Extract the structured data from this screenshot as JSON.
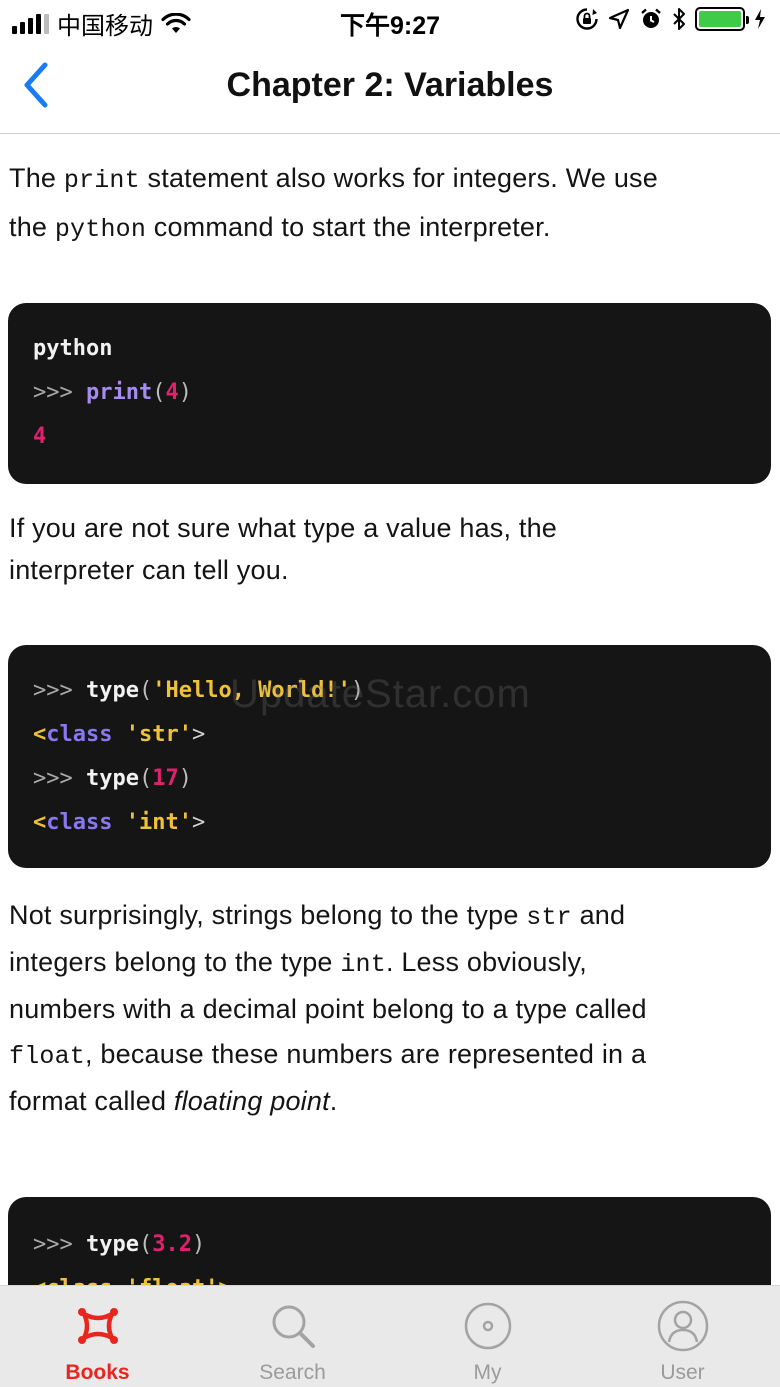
{
  "status_bar": {
    "carrier": "中国移动",
    "time": "下午9:27"
  },
  "nav": {
    "title": "Chapter 2: Variables"
  },
  "content": {
    "p1": {
      "t1": "The ",
      "c1": "print",
      "t2": " statement also works for integers. We use",
      "t3": "the ",
      "c2": "python",
      "t4": " command to start the interpreter."
    },
    "code1": {
      "line1": "python",
      "prompt": ">>> ",
      "func": "print",
      "paren_open": "(",
      "arg": "4",
      "paren_close": ")",
      "output": "4"
    },
    "p2": {
      "line1": "If you are not sure what type a value has, the",
      "line2": "interpreter can tell you."
    },
    "code2": {
      "prompt": ">>> ",
      "func": "type",
      "paren_open": "(",
      "paren_close": ")",
      "str_arg": "'Hello, World!'",
      "class_lt": "<",
      "class_kw": "class",
      "class_gt": ">",
      "str_type": "'str'",
      "int_arg": "17",
      "int_type": "'int'"
    },
    "p3": {
      "t1": "Not surprisingly, strings belong to the type ",
      "c1": "str",
      "t2": " and",
      "t3": "integers belong to the type ",
      "c2": "int",
      "t4": ". Less obviously,",
      "t5": "numbers with a decimal point belong to a type called",
      "c3": "float",
      "t6": ", because these numbers are represented in a",
      "t7": "format called ",
      "em1": "floating point",
      "t8": "."
    },
    "code3": {
      "prompt": ">>> ",
      "func": "type",
      "paren_open": "(",
      "arg": "3.2",
      "paren_close": ")",
      "partial": "<class 'float'>"
    },
    "watermark": "UpdateStar.com"
  },
  "tabs": [
    {
      "label": "Books",
      "icon": "books-icon",
      "active": true
    },
    {
      "label": "Search",
      "icon": "search-icon",
      "active": false
    },
    {
      "label": "My",
      "icon": "disc-icon",
      "active": false
    },
    {
      "label": "User",
      "icon": "user-icon",
      "active": false
    }
  ],
  "colors": {
    "accent_blue": "#1a7cf5",
    "accent_red": "#e8251f",
    "code_bg": "#151515",
    "battery_green": "#3fcb48"
  }
}
